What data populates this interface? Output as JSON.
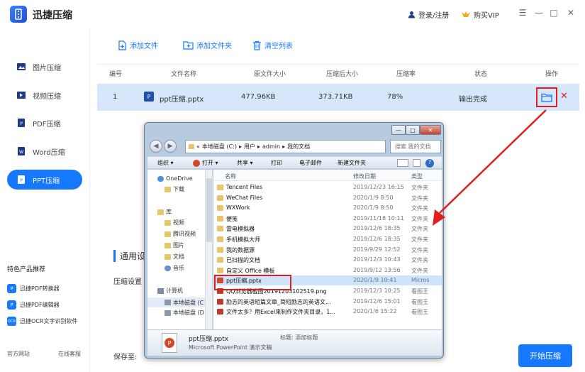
{
  "app": {
    "title": "迅捷压缩",
    "login": "登录/注册",
    "vip": "购买VIP",
    "minimize": "—",
    "maximize": "□",
    "close": "✕",
    "menu": "☰"
  },
  "sidebar": {
    "items": [
      {
        "label": "图片压缩",
        "active": false
      },
      {
        "label": "视频压缩",
        "active": false
      },
      {
        "label": "PDF压缩",
        "active": false
      },
      {
        "label": "Word压缩",
        "active": false
      },
      {
        "label": "PPT压缩",
        "active": true
      }
    ],
    "featured_title": "特色产品推荐",
    "products": [
      {
        "label": "迅捷PDF转换器",
        "badge": "P"
      },
      {
        "label": "迅捷PDF编辑器",
        "badge": "P"
      },
      {
        "label": "迅捷OCR文字识别软件",
        "badge": "OCR"
      }
    ],
    "footer": [
      "官方网站",
      "在线客服"
    ]
  },
  "toolbar": {
    "add_file": "添加文件",
    "add_folder": "添加文件夹",
    "clear_list": "清空列表"
  },
  "table": {
    "headers": [
      "编号",
      "文件名称",
      "原文件大小",
      "压缩后大小",
      "压缩率",
      "状态",
      "操作"
    ],
    "rows": [
      {
        "index": "1",
        "name": "ppt压缩.pptx",
        "orig_size": "477.96KB",
        "new_size": "373.71KB",
        "ratio": "78%",
        "status": "输出完成",
        "file_badge": "P"
      }
    ]
  },
  "settings": {
    "title": "通用设置",
    "label": "压缩设置",
    "save_to": "保存至:",
    "start": "开始压缩"
  },
  "dialog": {
    "minimize": "—",
    "maximize": "□",
    "close": "✕",
    "path": [
      "«",
      "本地磁盘 (C:)",
      "用户",
      "admin",
      "我的文档"
    ],
    "search_placeholder": "搜索 我的文档",
    "commands": [
      "组织 ▾",
      "打开 ▾",
      "共享 ▾",
      "打印",
      "电子邮件",
      "新建文件夹"
    ],
    "tree": [
      {
        "label": "OneDrive",
        "kind": "cloud"
      },
      {
        "label": "下载",
        "kind": "folder"
      },
      {
        "label": "库",
        "kind": "lib"
      },
      {
        "label": "视频",
        "kind": "folder"
      },
      {
        "label": "腾讯视频",
        "kind": "folder"
      },
      {
        "label": "图片",
        "kind": "folder"
      },
      {
        "label": "文档",
        "kind": "folder"
      },
      {
        "label": "音乐",
        "kind": "music"
      },
      {
        "label": "计算机",
        "kind": "pc"
      },
      {
        "label": "本地磁盘 (C",
        "kind": "drive"
      },
      {
        "label": "本地磁盘 (D",
        "kind": "drive"
      }
    ],
    "columns": [
      "名称",
      "修改日期",
      "类型"
    ],
    "files": [
      {
        "name": "Tencent Files",
        "date": "2019/12/23 16:15",
        "type": "文件夹",
        "kind": "folder"
      },
      {
        "name": "WeChat Files",
        "date": "2020/1/9 8:50",
        "type": "文件夹",
        "kind": "folder"
      },
      {
        "name": "WXWork",
        "date": "2020/1/9 8:50",
        "type": "文件夹",
        "kind": "folder"
      },
      {
        "name": "便笺",
        "date": "2019/11/18 10:11",
        "type": "文件夹",
        "kind": "folder"
      },
      {
        "name": "雷电模拟器",
        "date": "2019/12/6 18:35",
        "type": "文件夹",
        "kind": "folder"
      },
      {
        "name": "手机模拟大师",
        "date": "2019/12/6 18:35",
        "type": "文件夹",
        "kind": "folder"
      },
      {
        "name": "我的数据源",
        "date": "2019/9/29 12:52",
        "type": "文件夹",
        "kind": "folder"
      },
      {
        "name": "已扫描的文档",
        "date": "2019/12/3 10:43",
        "type": "文件夹",
        "kind": "folder"
      },
      {
        "name": "自定义 Office 模板",
        "date": "2019/9/12 13:56",
        "type": "文件夹",
        "kind": "folder"
      },
      {
        "name": "ppt压缩.pptx",
        "date": "2020/1/9 10:41",
        "type": "Micros",
        "kind": "ppt",
        "selected": true
      },
      {
        "name": "QQ浏览器截图20191203102519.png",
        "date": "2019/12/3 10:25",
        "type": "看图王",
        "kind": "img"
      },
      {
        "name": "励志的英语短篇文章_简短励志的英语文...",
        "date": "2019/12/6 15:01",
        "type": "看图王",
        "kind": "img"
      },
      {
        "name": "文件太多？用Excel来制作文件夹目录，1...",
        "date": "2020/1/6 15:22",
        "type": "看图王",
        "kind": "img"
      }
    ],
    "preview_name": "ppt压缩.pptx",
    "preview_type": "Microsoft PowerPoint 演示文稿",
    "preview_tag": "标题: 添加标题"
  }
}
